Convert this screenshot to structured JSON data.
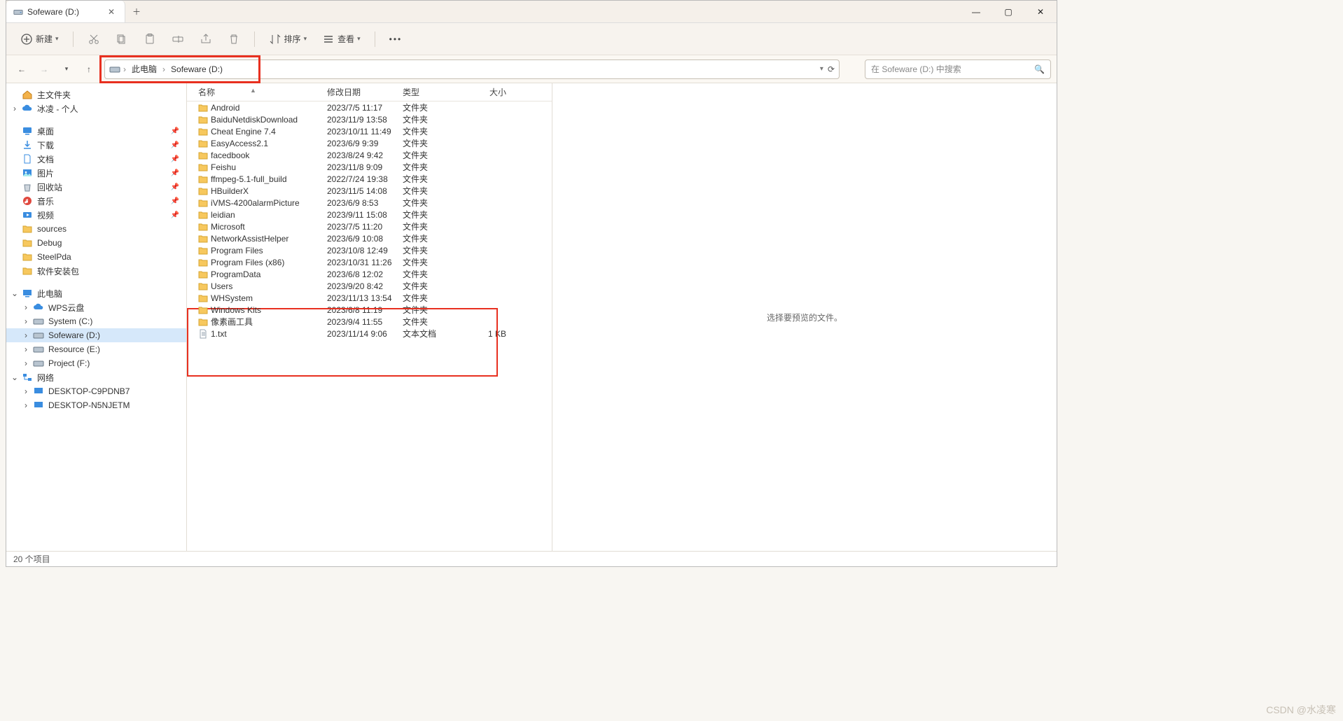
{
  "tab": {
    "title": "Sofeware (D:)"
  },
  "toolbar": {
    "new_label": "新建",
    "sort_label": "排序",
    "view_label": "查看"
  },
  "breadcrumb": {
    "pc": "此电脑",
    "drive": "Sofeware (D:)"
  },
  "search": {
    "placeholder": "在 Sofeware (D:) 中搜索"
  },
  "sidebar": {
    "home": "主文件夹",
    "user": "冰凌 - 个人",
    "quick": {
      "desktop": "桌面",
      "downloads": "下载",
      "documents": "文档",
      "pictures": "图片",
      "recycle": "回收站",
      "music": "音乐",
      "videos": "视频",
      "sources": "sources",
      "debug": "Debug",
      "steelpda": "SteelPda",
      "install": "软件安装包"
    },
    "pc": "此电脑",
    "drives": {
      "wps": "WPS云盘",
      "c": "System (C:)",
      "d": "Sofeware (D:)",
      "e": "Resource (E:)",
      "f": "Project (F:)"
    },
    "network": "网络",
    "hosts": {
      "h1": "DESKTOP-C9PDNB7",
      "h2": "DESKTOP-N5NJETM"
    }
  },
  "columns": {
    "name": "名称",
    "date": "修改日期",
    "type": "类型",
    "size": "大小"
  },
  "type_labels": {
    "folder": "文件夹",
    "txt": "文本文档"
  },
  "files": [
    {
      "name": "Android",
      "date": "2023/7/5 11:17",
      "type": "folder",
      "size": ""
    },
    {
      "name": "BaiduNetdiskDownload",
      "date": "2023/11/9 13:58",
      "type": "folder",
      "size": ""
    },
    {
      "name": "Cheat Engine 7.4",
      "date": "2023/10/11 11:49",
      "type": "folder",
      "size": ""
    },
    {
      "name": "EasyAccess2.1",
      "date": "2023/6/9 9:39",
      "type": "folder",
      "size": ""
    },
    {
      "name": "facedbook",
      "date": "2023/8/24 9:42",
      "type": "folder",
      "size": ""
    },
    {
      "name": "Feishu",
      "date": "2023/11/8 9:09",
      "type": "folder",
      "size": ""
    },
    {
      "name": "ffmpeg-5.1-full_build",
      "date": "2022/7/24 19:38",
      "type": "folder",
      "size": ""
    },
    {
      "name": "HBuilderX",
      "date": "2023/11/5 14:08",
      "type": "folder",
      "size": ""
    },
    {
      "name": "iVMS-4200alarmPicture",
      "date": "2023/6/9 8:53",
      "type": "folder",
      "size": ""
    },
    {
      "name": "leidian",
      "date": "2023/9/11 15:08",
      "type": "folder",
      "size": ""
    },
    {
      "name": "Microsoft",
      "date": "2023/7/5 11:20",
      "type": "folder",
      "size": ""
    },
    {
      "name": "NetworkAssistHelper",
      "date": "2023/6/9 10:08",
      "type": "folder",
      "size": ""
    },
    {
      "name": "Program Files",
      "date": "2023/10/8 12:49",
      "type": "folder",
      "size": ""
    },
    {
      "name": "Program Files (x86)",
      "date": "2023/10/31 11:26",
      "type": "folder",
      "size": ""
    },
    {
      "name": "ProgramData",
      "date": "2023/6/8 12:02",
      "type": "folder",
      "size": ""
    },
    {
      "name": "Users",
      "date": "2023/9/20 8:42",
      "type": "folder",
      "size": ""
    },
    {
      "name": "WHSystem",
      "date": "2023/11/13 13:54",
      "type": "folder",
      "size": ""
    },
    {
      "name": "Windows Kits",
      "date": "2023/6/8 11:19",
      "type": "folder",
      "size": ""
    },
    {
      "name": "像素画工具",
      "date": "2023/9/4 11:55",
      "type": "folder",
      "size": ""
    },
    {
      "name": "1.txt",
      "date": "2023/11/14 9:06",
      "type": "txt",
      "size": "1 KB"
    }
  ],
  "preview_hint": "选择要预览的文件。",
  "status": "20 个项目",
  "watermark": "CSDN @水凌寒"
}
